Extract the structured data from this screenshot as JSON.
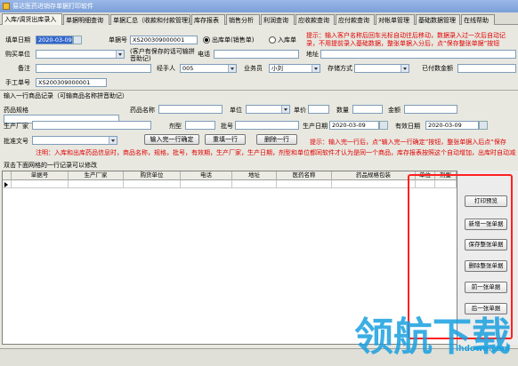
{
  "window": {
    "title": "易达医药进销存单据打印软件"
  },
  "tabs": [
    "入库/调货出库录入",
    "单据明细查询",
    "单据汇总（收款和付款管理）",
    "库存报表",
    "销售分析",
    "利润查询",
    "应收款查询",
    "应付款查询",
    "对帐单管理",
    "基础数据管理",
    "在线帮助"
  ],
  "header": {
    "date_label": "填单日期",
    "date_value": "2020-03-09",
    "doc_no_label": "单据号",
    "doc_no_value": "XS200309000001",
    "radio_out_label": "出库单(销售单)",
    "radio_in_label": "入库单",
    "hint": "提示：输入客户名称后回车光标自动往后移动，数据录入过一次后自动记录，不用提前录入基础数据，整张单据入分后，点“保存整张单据”按钮",
    "buyer_label": "购买单位",
    "buyer_value": "",
    "buyer_note": "(客户有保存的话可输拼音助记)",
    "phone_label": "电话",
    "address_label": "地址",
    "remark_label": "备注",
    "handler_label": "经手人",
    "handler_value": "005",
    "salesman_label": "业务员",
    "salesman_value": "小刘",
    "storage_label": "存储方式",
    "paid_label": "已付数金额",
    "manual_no_label": "手工单号",
    "manual_no_value": "XS200309000001"
  },
  "entry": {
    "section_title": "输入一行商品记录（可输商品名称拼音助记）",
    "spec_label": "药品规格",
    "name_label": "药品名称",
    "unit_label": "单位",
    "price_label": "单价",
    "qty_label": "数量",
    "amount_label": "金额",
    "maker_label": "生产厂家",
    "form_label": "剂型",
    "batch_label": "批号",
    "mfg_date_label": "生产日期",
    "mfg_date_value": "2020-03-09",
    "expiry_label": "有效日期",
    "expiry_value": "2020-03-09",
    "approval_label": "批准文号",
    "btn_confirm": "输入完一行确定",
    "btn_redo": "重填一行",
    "btn_delete": "删除一行",
    "hint2": "提示：输入完一行后，点“输入完一行确定”按钮，整张单据入后点“保存",
    "note": "注明：入库和出库药品信息时，商品名称，规格，批号，有效期，生产厂家，生产日期，剂型和单位都同软件才认为是同一个商品，库存报表按照这个自动增加，出库时自动减少"
  },
  "grid": {
    "caption": "双击下面网格的一行记录可以修改",
    "columns": [
      "单据号",
      "生产厂家",
      "购货单位",
      "电话",
      "地址",
      "医药名称",
      "药品规格包装",
      "单位",
      "剂型"
    ]
  },
  "side_buttons": [
    "打印预览",
    "新增一张单据",
    "保存整张单据",
    "删除整张单据",
    "前一张单据",
    "后一张单据"
  ],
  "watermark": {
    "brand": "领航下载",
    "url": "lhdown.com"
  },
  "colors": {
    "hint_red": "#e00000",
    "highlight_red": "#ff2020",
    "watermark_blue": "#1aa0e0"
  }
}
